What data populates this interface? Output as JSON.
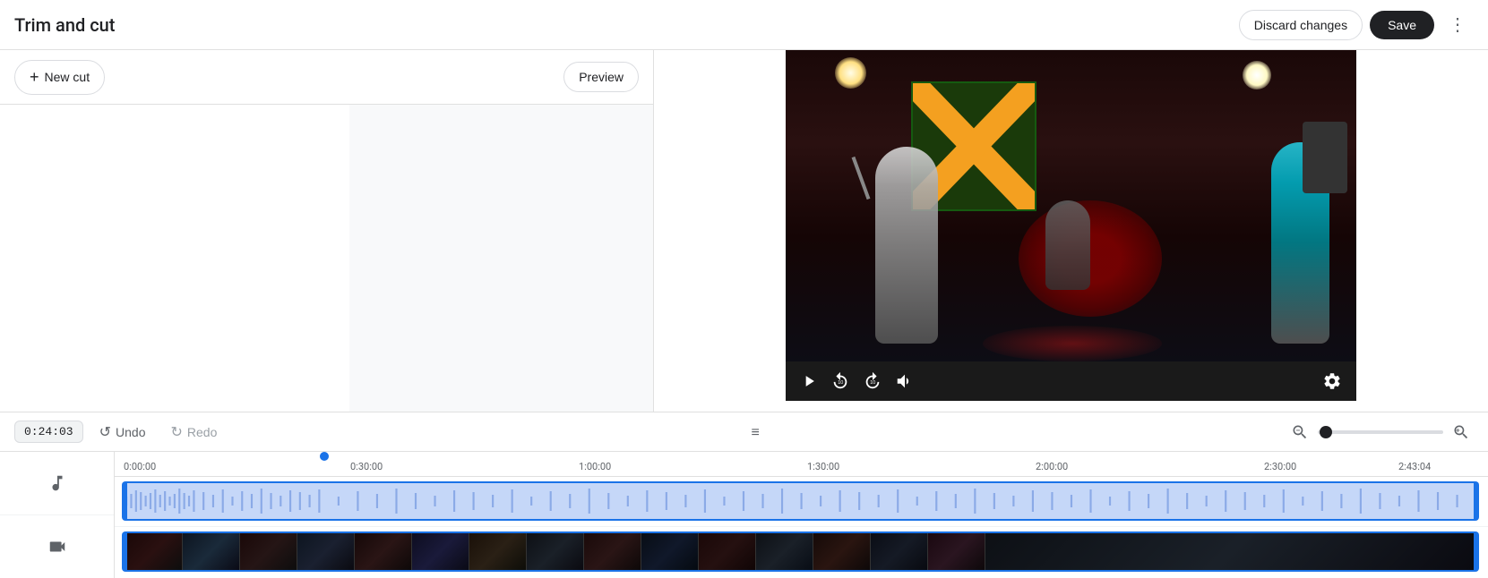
{
  "header": {
    "title": "Trim and cut",
    "discard_label": "Discard changes",
    "save_label": "Save"
  },
  "toolbar": {
    "new_cut_label": "New cut",
    "preview_label": "Preview"
  },
  "timeline_bar": {
    "time_display": "0:24:03",
    "undo_label": "Undo",
    "redo_label": "Redo"
  },
  "timeline": {
    "markers": [
      "0:00:00",
      "0:30:00",
      "1:00:00",
      "1:30:00",
      "2:00:00",
      "2:30:00",
      "2:43:04"
    ]
  },
  "video": {
    "has_content": true
  },
  "icons": {
    "plus": "+",
    "more_vert": "⋮",
    "undo": "↺",
    "redo": "↻",
    "play": "▶",
    "replay10": "⟳",
    "forward10": "⟳",
    "volume": "🔊",
    "settings": "⚙",
    "zoom_out": "−",
    "zoom_in": "+",
    "music": "♪",
    "video_cam": "□",
    "drag_handle": "≡"
  }
}
